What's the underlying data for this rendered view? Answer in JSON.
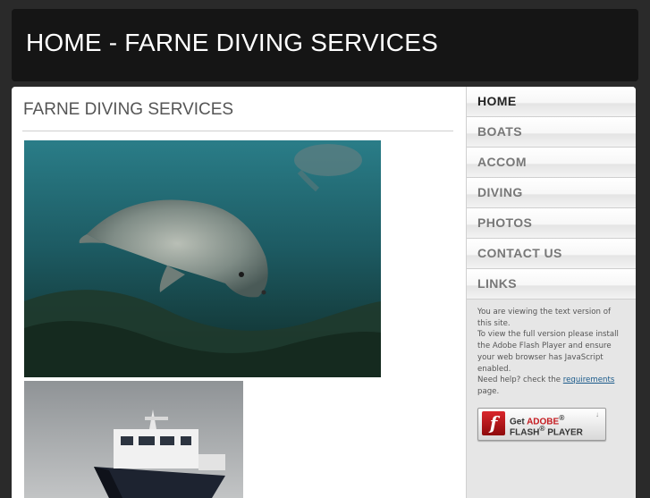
{
  "header": {
    "title": "HOME - FARNE DIVING SERVICES"
  },
  "main": {
    "title": "FARNE DIVING SERVICES",
    "images": [
      {
        "name": "seal-photo"
      },
      {
        "name": "boat-photo"
      }
    ]
  },
  "sidebar": {
    "nav": [
      {
        "label": "HOME",
        "active": true
      },
      {
        "label": "BOATS"
      },
      {
        "label": "ACCOM"
      },
      {
        "label": "DIVING"
      },
      {
        "label": "PHOTOS"
      },
      {
        "label": "CONTACT US"
      },
      {
        "label": "LINKS"
      }
    ],
    "notice": {
      "line1": "You are viewing the text version of this site.",
      "line2": "To view the full version please install the Adobe Flash Player and ensure your web browser has JavaScript enabled.",
      "line3_pre": "Need help? check the ",
      "line3_link": "requirements",
      "line3_post": " page."
    },
    "flash_badge": {
      "logo_glyph": "f",
      "get": "Get ",
      "brand": "ADOBE",
      "brand_mark": "®",
      "product": "FLASH",
      "product_mark": "®",
      "player": " PLAYER",
      "download_icon": "↓"
    }
  },
  "colors": {
    "background": "#2a2a2a",
    "header_bg": "#151515",
    "sidebar_bg": "#e6e6e6",
    "active_nav_text": "#222222",
    "nav_text": "#777777"
  }
}
